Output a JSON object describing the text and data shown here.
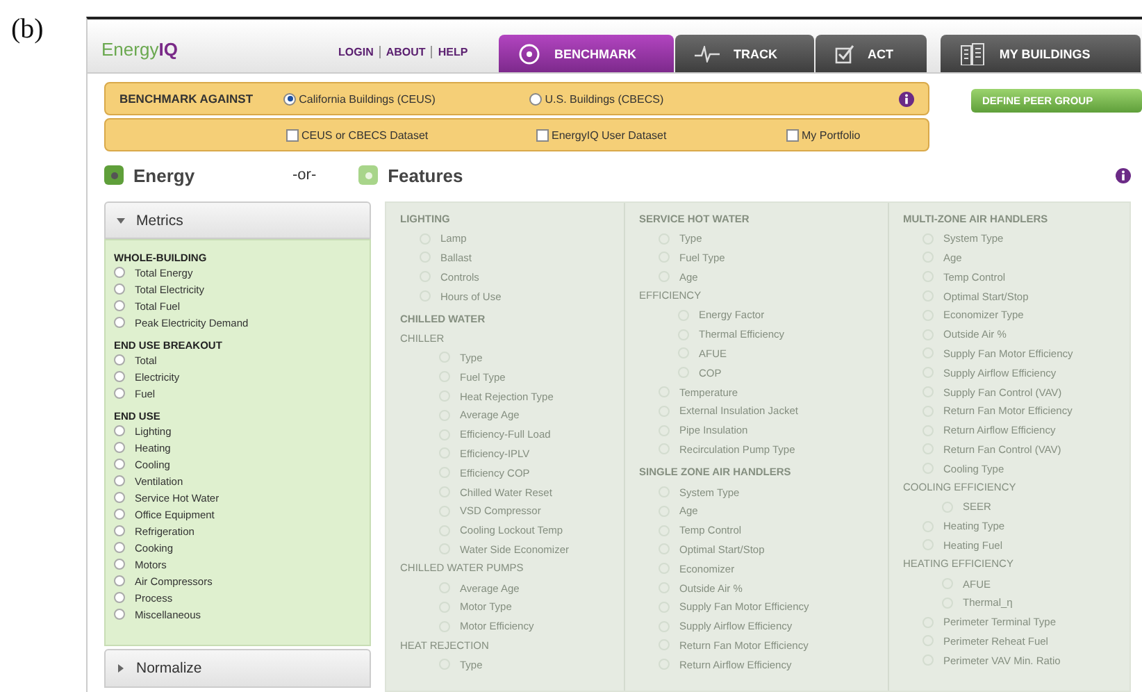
{
  "figure_label": "(b)",
  "header": {
    "logo_prefix": "Energy",
    "logo_suffix": "IQ",
    "links": [
      "LOGIN",
      "ABOUT",
      "HELP"
    ],
    "tabs": [
      {
        "label": "BENCHMARK",
        "selected": true
      },
      {
        "label": "TRACK",
        "selected": false
      },
      {
        "label": "ACT",
        "selected": false
      },
      {
        "label": "MY BUILDINGS",
        "selected": false
      }
    ]
  },
  "benchmark_bar": {
    "title": "BENCHMARK AGAINST",
    "radios": [
      {
        "label": "California Buildings (CEUS)",
        "selected": true
      },
      {
        "label": "U.S. Buildings (CBECS)",
        "selected": false
      }
    ],
    "checkboxes": [
      {
        "label": "CEUS or CBECS Dataset",
        "checked": false
      },
      {
        "label": "EnergyIQ User Dataset",
        "checked": false
      },
      {
        "label": "My Portfolio",
        "checked": false
      }
    ]
  },
  "define_button": "DEFINE PEER GROUP",
  "modes": [
    {
      "label": "Energy",
      "selected": true
    },
    {
      "label": "Features",
      "selected": false
    }
  ],
  "or_label": "-or-",
  "accordion": [
    {
      "label": "Metrics",
      "expanded": true,
      "groups": [
        {
          "title": "WHOLE-BUILDING",
          "options": [
            {
              "label": "Total Energy",
              "selected": false
            },
            {
              "label": "Total Electricity",
              "selected": false
            },
            {
              "label": "Total Fuel",
              "selected": false
            },
            {
              "label": "Peak Electricity Demand",
              "selected": false
            }
          ]
        },
        {
          "title": "END USE BREAKOUT",
          "options": [
            {
              "label": "Total",
              "selected": false
            },
            {
              "label": "Electricity",
              "selected": false
            },
            {
              "label": "Fuel",
              "selected": false
            }
          ]
        },
        {
          "title": "END USE",
          "options": [
            {
              "label": "Lighting",
              "selected": false
            },
            {
              "label": "Heating",
              "selected": false
            },
            {
              "label": "Cooling",
              "selected": false
            },
            {
              "label": "Ventilation",
              "selected": false
            },
            {
              "label": "Service Hot Water",
              "selected": false
            },
            {
              "label": "Office Equipment",
              "selected": false
            },
            {
              "label": "Refrigeration",
              "selected": false
            },
            {
              "label": "Cooking",
              "selected": false
            },
            {
              "label": "Motors",
              "selected": false
            },
            {
              "label": "Air Compressors",
              "selected": false
            },
            {
              "label": "Process",
              "selected": false
            },
            {
              "label": "Miscellaneous",
              "selected": false
            }
          ]
        }
      ]
    },
    {
      "label": "Normalize",
      "expanded": false
    }
  ],
  "features": {
    "disabled": true,
    "columns": [
      [
        {
          "kind": "heading",
          "label": "LIGHTING",
          "children": [
            {
              "kind": "option",
              "label": "Lamp",
              "selected": false
            },
            {
              "kind": "option",
              "label": "Ballast",
              "selected": false
            },
            {
              "kind": "option",
              "label": "Controls",
              "selected": false
            },
            {
              "kind": "option",
              "label": "Hours of Use",
              "selected": false
            }
          ]
        },
        {
          "kind": "heading",
          "label": "CHILLED WATER",
          "children": [
            {
              "kind": "subheading",
              "label": "CHILLER",
              "children": [
                {
                  "kind": "option",
                  "label": "Type",
                  "selected": false
                },
                {
                  "kind": "option",
                  "label": "Fuel Type",
                  "selected": false
                },
                {
                  "kind": "option",
                  "label": "Heat Rejection Type",
                  "selected": false
                },
                {
                  "kind": "option",
                  "label": "Average Age",
                  "selected": false
                },
                {
                  "kind": "option",
                  "label": "Efficiency-Full Load",
                  "selected": false
                },
                {
                  "kind": "option",
                  "label": "Efficiency-IPLV",
                  "selected": false
                },
                {
                  "kind": "option",
                  "label": "Efficiency COP",
                  "selected": false
                },
                {
                  "kind": "option",
                  "label": "Chilled Water Reset",
                  "selected": false
                },
                {
                  "kind": "option",
                  "label": "VSD Compressor",
                  "selected": false
                },
                {
                  "kind": "option",
                  "label": "Cooling Lockout Temp",
                  "selected": false
                },
                {
                  "kind": "option",
                  "label": "Water Side Economizer",
                  "selected": false
                }
              ]
            },
            {
              "kind": "subheading",
              "label": "CHILLED WATER PUMPS",
              "children": [
                {
                  "kind": "option",
                  "label": "Average Age",
                  "selected": false
                },
                {
                  "kind": "option",
                  "label": "Motor Type",
                  "selected": false
                },
                {
                  "kind": "option",
                  "label": "Motor Efficiency",
                  "selected": false
                }
              ]
            },
            {
              "kind": "subheading",
              "label": "HEAT REJECTION",
              "children": [
                {
                  "kind": "option",
                  "label": "Type",
                  "selected": false
                }
              ]
            }
          ]
        }
      ],
      [
        {
          "kind": "heading",
          "label": "SERVICE HOT WATER",
          "children": [
            {
              "kind": "option",
              "label": "Type",
              "selected": false
            },
            {
              "kind": "option",
              "label": "Fuel Type",
              "selected": false
            },
            {
              "kind": "option",
              "label": "Age",
              "selected": false
            },
            {
              "kind": "subheading",
              "label": "EFFICIENCY",
              "children": [
                {
                  "kind": "option",
                  "label": "Energy Factor",
                  "selected": false
                },
                {
                  "kind": "option",
                  "label": "Thermal Efficiency",
                  "selected": false
                },
                {
                  "kind": "option",
                  "label": "AFUE",
                  "selected": false
                },
                {
                  "kind": "option",
                  "label": "COP",
                  "selected": false
                }
              ]
            },
            {
              "kind": "option",
              "label": "Temperature",
              "selected": false
            },
            {
              "kind": "option",
              "label": "External Insulation Jacket",
              "selected": false
            },
            {
              "kind": "option",
              "label": "Pipe Insulation",
              "selected": false
            },
            {
              "kind": "option",
              "label": "Recirculation Pump Type",
              "selected": false
            }
          ]
        },
        {
          "kind": "heading",
          "label": "SINGLE ZONE AIR HANDLERS",
          "children": [
            {
              "kind": "option",
              "label": "System Type",
              "selected": false
            },
            {
              "kind": "option",
              "label": "Age",
              "selected": false
            },
            {
              "kind": "option",
              "label": "Temp Control",
              "selected": false
            },
            {
              "kind": "option",
              "label": "Optimal Start/Stop",
              "selected": false
            },
            {
              "kind": "option",
              "label": "Economizer",
              "selected": false
            },
            {
              "kind": "option",
              "label": "Outside Air %",
              "selected": false
            },
            {
              "kind": "option",
              "label": "Supply Fan Motor Efficiency",
              "selected": false
            },
            {
              "kind": "option",
              "label": "Supply Airflow Efficiency",
              "selected": false
            },
            {
              "kind": "option",
              "label": "Return Fan Motor Efficiency",
              "selected": false
            },
            {
              "kind": "option",
              "label": "Return Airflow Efficiency",
              "selected": false
            }
          ]
        }
      ],
      [
        {
          "kind": "heading",
          "label": "MULTI-ZONE AIR HANDLERS",
          "children": [
            {
              "kind": "option",
              "label": "System Type",
              "selected": false
            },
            {
              "kind": "option",
              "label": "Age",
              "selected": false
            },
            {
              "kind": "option",
              "label": "Temp Control",
              "selected": false
            },
            {
              "kind": "option",
              "label": "Optimal Start/Stop",
              "selected": false
            },
            {
              "kind": "option",
              "label": "Economizer Type",
              "selected": false
            },
            {
              "kind": "option",
              "label": "Outside Air %",
              "selected": false
            },
            {
              "kind": "option",
              "label": "Supply Fan Motor Efficiency",
              "selected": false
            },
            {
              "kind": "option",
              "label": "Supply Airflow Efficiency",
              "selected": false
            },
            {
              "kind": "option",
              "label": "Supply Fan Control (VAV)",
              "selected": false
            },
            {
              "kind": "option",
              "label": "Return Fan Motor Efficiency",
              "selected": false
            },
            {
              "kind": "option",
              "label": "Return Airflow Efficiency",
              "selected": false
            },
            {
              "kind": "option",
              "label": "Return Fan Control (VAV)",
              "selected": false
            },
            {
              "kind": "option",
              "label": "Cooling Type",
              "selected": false
            },
            {
              "kind": "subheading",
              "label": "COOLING EFFICIENCY",
              "children": [
                {
                  "kind": "option",
                  "label": "SEER",
                  "selected": false
                }
              ]
            },
            {
              "kind": "option",
              "label": "Heating Type",
              "selected": false
            },
            {
              "kind": "option",
              "label": "Heating Fuel",
              "selected": false
            },
            {
              "kind": "subheading",
              "label": "HEATING EFFICIENCY",
              "children": [
                {
                  "kind": "option",
                  "label": "AFUE",
                  "selected": false
                },
                {
                  "kind": "option",
                  "label": "Thermal_η",
                  "selected": false
                }
              ]
            },
            {
              "kind": "option",
              "label": "Perimeter Terminal Type",
              "selected": false
            },
            {
              "kind": "option",
              "label": "Perimeter Reheat Fuel",
              "selected": false
            },
            {
              "kind": "option",
              "label": "Perimeter VAV Min. Ratio",
              "selected": false
            }
          ]
        }
      ]
    ]
  }
}
